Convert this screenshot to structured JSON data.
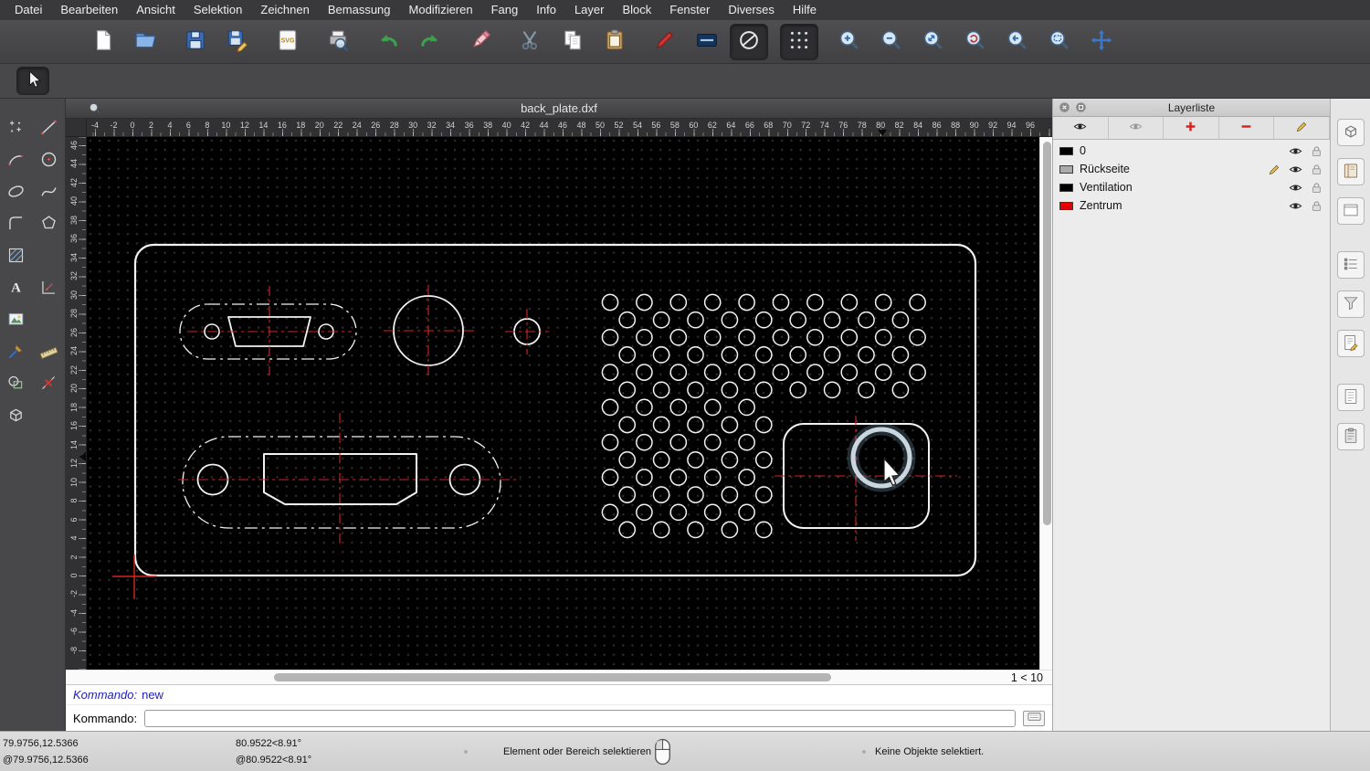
{
  "menu": {
    "items": [
      "Datei",
      "Bearbeiten",
      "Ansicht",
      "Selektion",
      "Zeichnen",
      "Bemassung",
      "Modifizieren",
      "Fang",
      "Info",
      "Layer",
      "Block",
      "Fenster",
      "Diverses",
      "Hilfe"
    ]
  },
  "toolbar": {
    "buttons": [
      {
        "name": "new-document-button",
        "icon": "new-file-icon"
      },
      {
        "name": "open-file-button",
        "icon": "open-folder-icon"
      },
      {
        "name": "save-button",
        "icon": "save-icon",
        "gap": true
      },
      {
        "name": "save-as-button",
        "icon": "save-as-icon"
      },
      {
        "name": "export-svg-button",
        "icon": "svg-export-icon",
        "gap": true
      },
      {
        "name": "print-preview-button",
        "icon": "print-preview-icon",
        "gap": true
      },
      {
        "name": "undo-button",
        "icon": "undo-icon",
        "gap": true
      },
      {
        "name": "redo-button",
        "icon": "redo-icon"
      },
      {
        "name": "delete-button",
        "icon": "eraser-icon",
        "gap": true
      },
      {
        "name": "cut-button",
        "icon": "scissors-icon",
        "gap": true
      },
      {
        "name": "copy-button",
        "icon": "copy-icon"
      },
      {
        "name": "paste-button",
        "icon": "clipboard-icon"
      },
      {
        "name": "edit-attributes-button",
        "icon": "pen-icon",
        "gap": true
      },
      {
        "name": "line-attributes-button",
        "icon": "line-attributes-icon"
      },
      {
        "name": "linetype-none-button",
        "icon": "no-linetype-icon",
        "pressed": true
      },
      {
        "name": "grid-toggle-button",
        "icon": "grid-icon",
        "pressed": true,
        "gap": true
      },
      {
        "name": "zoom-in-button",
        "icon": "zoom-in-icon",
        "gap": true
      },
      {
        "name": "zoom-out-button",
        "icon": "zoom-out-icon"
      },
      {
        "name": "zoom-auto-button",
        "icon": "zoom-auto-icon"
      },
      {
        "name": "zoom-redraw-button",
        "icon": "zoom-redraw-icon"
      },
      {
        "name": "zoom-previous-button",
        "icon": "zoom-previous-icon"
      },
      {
        "name": "zoom-window-button",
        "icon": "zoom-window-icon"
      },
      {
        "name": "zoom-pan-button",
        "icon": "pan-icon"
      }
    ],
    "pointer_button": {
      "name": "selection-pointer-button",
      "icon": "pointer-icon",
      "pressed": true
    }
  },
  "palette": {
    "tools": [
      {
        "name": "point-tool",
        "icon": "point-icon"
      },
      {
        "name": "line-tool",
        "icon": "line-icon"
      },
      {
        "name": "arc-tool",
        "icon": "arc-icon"
      },
      {
        "name": "circle-tool",
        "icon": "circle-icon"
      },
      {
        "name": "ellipse-tool",
        "icon": "ellipse-icon"
      },
      {
        "name": "spline-tool",
        "icon": "spline-icon"
      },
      {
        "name": "polyline-tool",
        "icon": "polyline-icon"
      },
      {
        "name": "polygon-tool",
        "icon": "polygon-icon"
      },
      {
        "name": "hatch-tool",
        "icon": "hatch-icon"
      },
      null,
      {
        "name": "text-tool",
        "icon": "text-icon"
      },
      {
        "name": "dimension-tool",
        "icon": "dimension-icon"
      },
      {
        "name": "image-tool",
        "icon": "image-icon"
      },
      null,
      {
        "name": "modify-tool",
        "icon": "brush-icon"
      },
      {
        "name": "measure-tool",
        "icon": "ruler-icon"
      },
      {
        "name": "block-tool",
        "icon": "block-icon"
      },
      {
        "name": "snap-tool",
        "icon": "snap-cross-icon"
      },
      {
        "name": "iso-view-tool",
        "icon": "cube-icon"
      },
      null
    ]
  },
  "document": {
    "title": "back_plate.dxf"
  },
  "rulers": {
    "h_labels": [
      -4,
      -2,
      0,
      2,
      4,
      6,
      8,
      10,
      12,
      14,
      16,
      18,
      20,
      22,
      24,
      26,
      28,
      30,
      32,
      34,
      36,
      38,
      40,
      42,
      44,
      46,
      48,
      50,
      52,
      54,
      56,
      58,
      60,
      62,
      64,
      66,
      68,
      70,
      72,
      74,
      76,
      78,
      80,
      82,
      84,
      86,
      88,
      90,
      92,
      94,
      96
    ],
    "v_labels": [
      46,
      44,
      42,
      40,
      38,
      36,
      34,
      32,
      30,
      28,
      26,
      24,
      22,
      20,
      18,
      16,
      14,
      12,
      10,
      8,
      6,
      4,
      2,
      0,
      -2,
      -4,
      -6,
      -8
    ]
  },
  "pager": "1 < 10",
  "command": {
    "history_label": "Kommando:",
    "history_value": "new",
    "prompt_label": "Kommando:",
    "input_value": ""
  },
  "layer_panel": {
    "title": "Layerliste",
    "toolbar": [
      {
        "name": "show-all-layers-button",
        "icon": "eye-icon"
      },
      {
        "name": "hide-all-layers-button",
        "icon": "eye-off-icon"
      },
      {
        "name": "add-layer-button",
        "icon": "plus-icon"
      },
      {
        "name": "remove-layer-button",
        "icon": "minus-icon"
      },
      {
        "name": "edit-layer-button",
        "icon": "pencil-icon"
      }
    ],
    "layers": [
      {
        "name": "0",
        "color": "#000000",
        "active": false
      },
      {
        "name": "Rückseite",
        "color": "#aaaaaa",
        "active": true
      },
      {
        "name": "Ventilation",
        "color": "#000000",
        "active": false
      },
      {
        "name": "Zentrum",
        "color": "#e60000",
        "active": false
      }
    ]
  },
  "dock_sidebar": {
    "buttons": [
      {
        "name": "dock-block-button",
        "icon": "dock-block-icon"
      },
      {
        "name": "dock-library-button",
        "icon": "dock-book-icon"
      },
      {
        "name": "dock-window-button",
        "icon": "dock-window-icon"
      },
      {
        "name": "dock-list-button",
        "icon": "dock-list-icon",
        "break": true
      },
      {
        "name": "dock-filter-button",
        "icon": "dock-filter-icon"
      },
      {
        "name": "dock-properties-button",
        "icon": "dock-properties-icon"
      },
      {
        "name": "dock-notes-button",
        "icon": "dock-notes-icon",
        "break": true
      },
      {
        "name": "dock-clipboard-button",
        "icon": "dock-clipboard-icon"
      }
    ]
  },
  "statusbar": {
    "abs_coord": "79.9756,12.5366",
    "rel_coord": "@79.9756,12.5366",
    "abs_polar": "80.9522<8.91°",
    "rel_polar": "@80.9522<8.91°",
    "hint": "Element oder Bereich selektieren",
    "selection": "Keine Objekte selektiert."
  },
  "colors": {
    "accent_red": "#d42525",
    "drawing_line": "#f2f2f2",
    "canvas_bg": "#000000",
    "command_text": "#2020c0"
  }
}
